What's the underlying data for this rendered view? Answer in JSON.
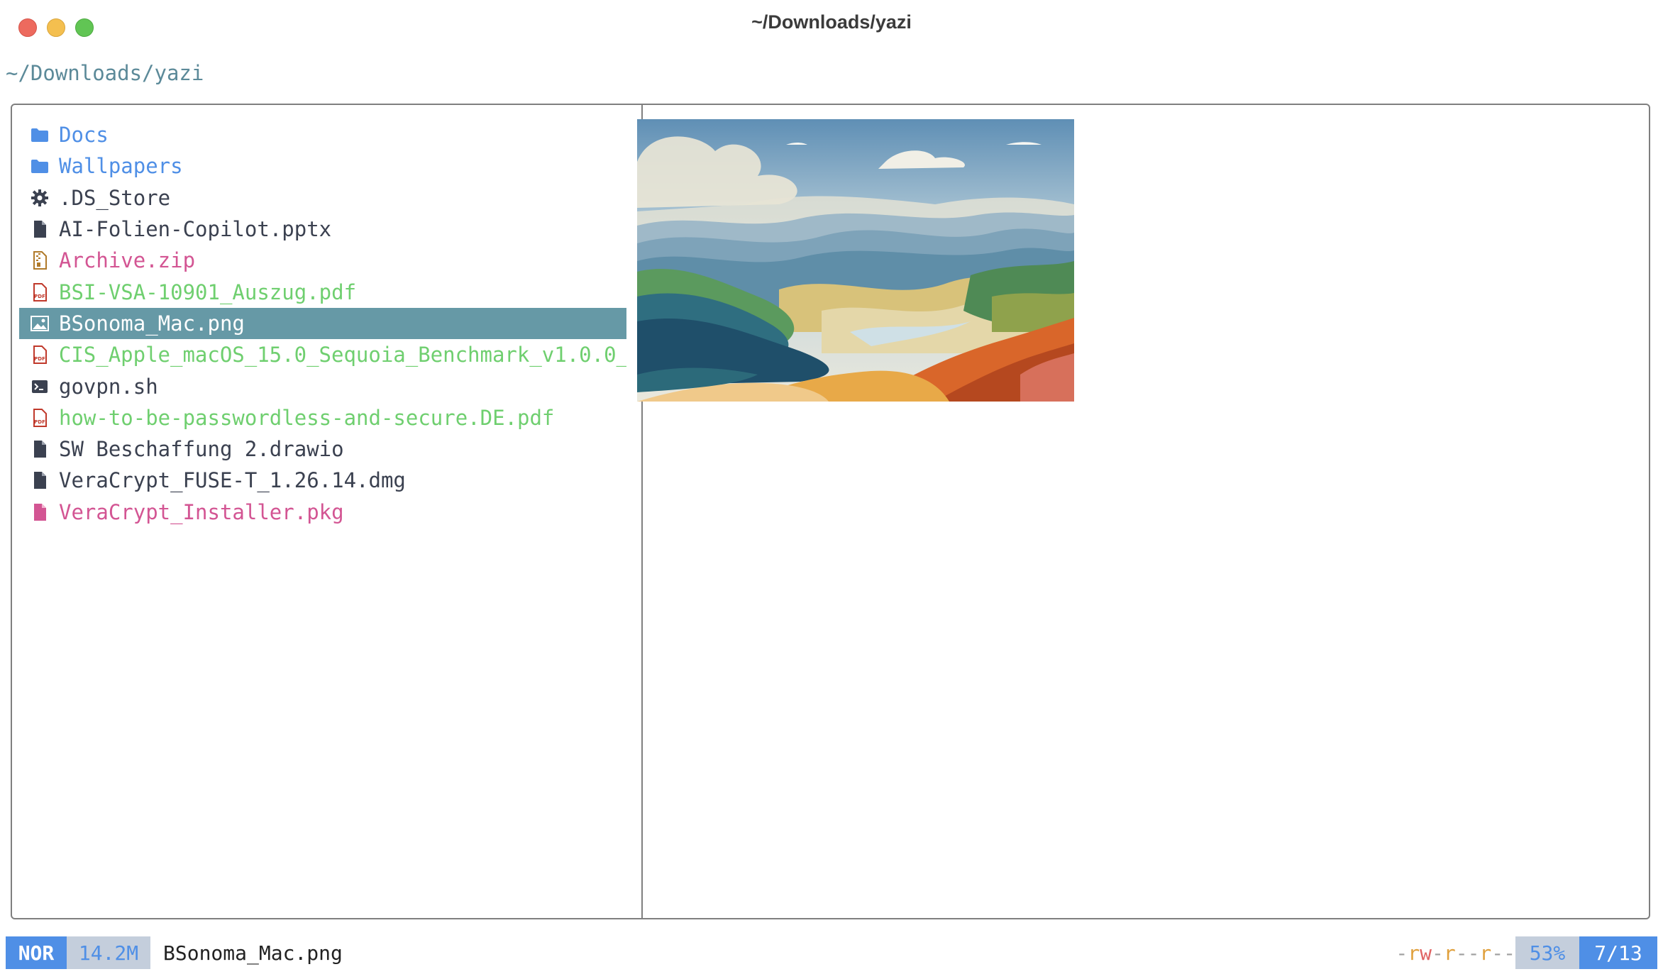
{
  "window": {
    "title": "~/Downloads/yazi"
  },
  "header": {
    "path": "~/Downloads/yazi"
  },
  "files": [
    {
      "name": "Docs",
      "kind": "folder",
      "icon": "folder-icon",
      "color": "#4f8fe6"
    },
    {
      "name": "Wallpapers",
      "kind": "folder",
      "icon": "folder-icon",
      "color": "#4f8fe6"
    },
    {
      "name": ".DS_Store",
      "kind": "config",
      "icon": "gear-icon",
      "color": "#3b4150"
    },
    {
      "name": "AI-Folien-Copilot.pptx",
      "kind": "document",
      "icon": "file-icon",
      "color": "#3b4150"
    },
    {
      "name": "Archive.zip",
      "kind": "archive",
      "icon": "zip-icon",
      "color": "#d35593"
    },
    {
      "name": "BSI-VSA-10901_Auszug.pdf",
      "kind": "pdf",
      "icon": "pdf-icon",
      "color": "#6fcf6f"
    },
    {
      "name": "BSonoma_Mac.png",
      "kind": "image",
      "icon": "image-icon",
      "selected": true
    },
    {
      "name": "CIS_Apple_macOS_15.0_Sequoia_Benchmark_v1.0.0_",
      "kind": "pdf",
      "icon": "pdf-icon",
      "color": "#6fcf6f"
    },
    {
      "name": "govpn.sh",
      "kind": "script",
      "icon": "terminal-icon",
      "color": "#3b4150"
    },
    {
      "name": "how-to-be-passwordless-and-secure.DE.pdf",
      "kind": "pdf",
      "icon": "pdf-icon",
      "color": "#6fcf6f"
    },
    {
      "name": "SW Beschaffung 2.drawio",
      "kind": "document",
      "icon": "file-icon",
      "color": "#3b4150"
    },
    {
      "name": "VeraCrypt_FUSE-T_1.26.14.dmg",
      "kind": "document",
      "icon": "file-icon",
      "color": "#3b4150"
    },
    {
      "name": "VeraCrypt_Installer.pkg",
      "kind": "package",
      "icon": "package-icon",
      "color": "#d35593"
    }
  ],
  "status": {
    "mode": "NOR",
    "size": "14.2M",
    "filename": "BSonoma_Mac.png",
    "perm_parts": [
      "-",
      "r",
      "w",
      "-",
      "r",
      "-",
      "-",
      "r",
      "-",
      "-"
    ],
    "percent": "53%",
    "position": "7/13"
  }
}
